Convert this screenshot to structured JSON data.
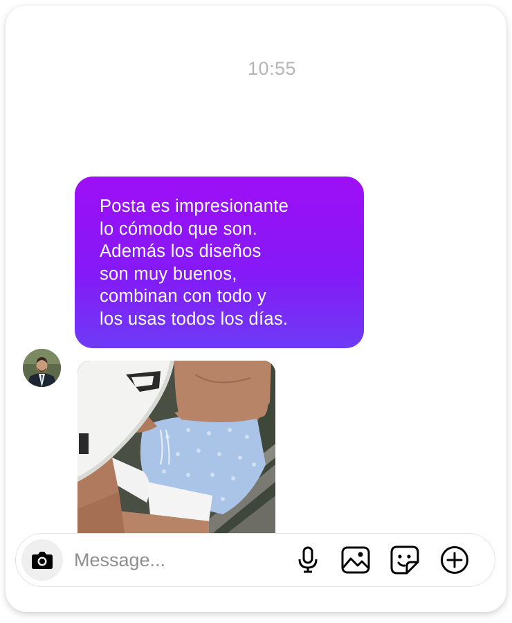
{
  "thread": {
    "timestamp": "10:55",
    "messages": [
      {
        "sender": "me",
        "text": "Posta es impresionante\nlo cómodo que son.\nAdemás los diseños\nson muy buenos,\ncombinan con todo y\nlos usas todos los días."
      }
    ]
  },
  "composer": {
    "placeholder": "Message...",
    "camera_icon": "camera-icon",
    "mic_icon": "microphone-icon",
    "gallery_icon": "image-gallery-icon",
    "sticker_icon": "sticker-icon",
    "plus_icon": "plus-circle-icon"
  },
  "colors": {
    "bubble_gradient_top": "#9e0ff5",
    "bubble_gradient_bottom": "#6d3bf5",
    "timestamp": "#b5b5b5",
    "placeholder": "#8e8e8e"
  }
}
